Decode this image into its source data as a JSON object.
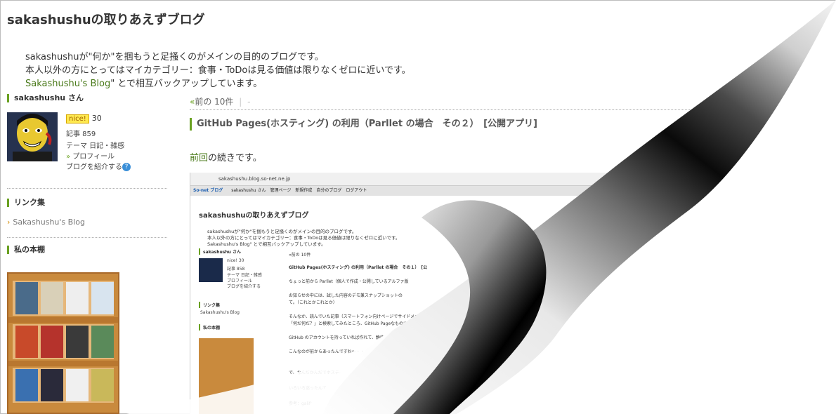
{
  "blog": {
    "title": "sakashushuの取りあえずブログ",
    "desc_line1": "sakashushuが\"何か\"を掴もうと足掻くのがメインの目的のブログです。",
    "desc_line2": "本人以外の方にとってはマイカテゴリー：食事・ToDoは見る価値は限りなくゼロに近いです。",
    "desc_line3_link": "Sakashushu's Blog",
    "desc_line3_rest": "\" とで相互バックアップしています。"
  },
  "sidebar": {
    "user_heading": "sakashushu さん",
    "nice_label": "nice!",
    "nice_count": "30",
    "articles": "記事 859",
    "theme": "テーマ 日記・雑感",
    "profile": "プロフィール",
    "introduce": "ブログを紹介する",
    "links_heading": "リンク集",
    "link_item": "Sakashushu's Blog",
    "shelf_heading": "私の本棚"
  },
  "main": {
    "prev": "前の 10件",
    "sep": "|",
    "dash": "-",
    "post_title": "GitHub Pages(ホスティング) の利用（Parllet の場合　その２）　[公開アプリ]",
    "body_link": "前回",
    "body_rest": "の続きです。"
  },
  "screenshot": {
    "url": "sakashushu.blog.so-net.ne.jp",
    "toolbar_logo": "So-net ブログ",
    "toolbar_items": "sakashushu さん　管理ページ　新規作成　自分のブログ　ログアウト",
    "title": "sakashushuの取りあえずブログ",
    "desc_line1": "sakashushuが\"何か\"を掴もうと足掻くのがメインの目的のブログです。",
    "desc_line2": "本人以外の方にとってはマイカテゴリー：食事・ToDoは見る価値は限りなくゼロに近いです。",
    "desc_line3": "Sakashushu's Blog\" とで相互バックアップしています。",
    "user_heading": "sakashushu さん",
    "nice": "nice! 30",
    "articles": "記事 858",
    "theme": "テーマ 日記・雑感",
    "profile": "プロフィール",
    "introduce": "ブログを紹介する",
    "links_heading": "リンク集",
    "link_item": "Sakashushu's Blog",
    "shelf_heading": "私の本棚",
    "prev": "«前の 10件",
    "post_title": "GitHub Pages(ホスティング) の利用（Parllet の場合　その１）　[公",
    "p1": "ちょっと前から Parllet（個人で作成・公開しているアルファ版",
    "p2": "お知らせの中には、試した内容のデモ兼スナップショットの",
    "p3": "て。（これとかこれとか）",
    "p4": "そんなか、読んでいた記事（スマートフォン向けページでサイドメニューを",
    "p5": "「何だ何だ？」と検索してみたところ、GitHub Pageなものでした。",
    "p6": "GitHub のアカウントを持っていれば作れて、静的ページのみですが公開リポジト",
    "p7": "こんなのが前からあったんですね〜・・・ひとっつも知りませんでした。",
    "p8": "で、なんだかんだでホスティングできたので、ほぼ備忘録としてまとめ",
    "p9": "いろいろ迷ったんですが、私の場合はデモページ作成が主な",
    "p10": "参考：galife: GitHub の プロジェクトページ を 素敵な"
  }
}
